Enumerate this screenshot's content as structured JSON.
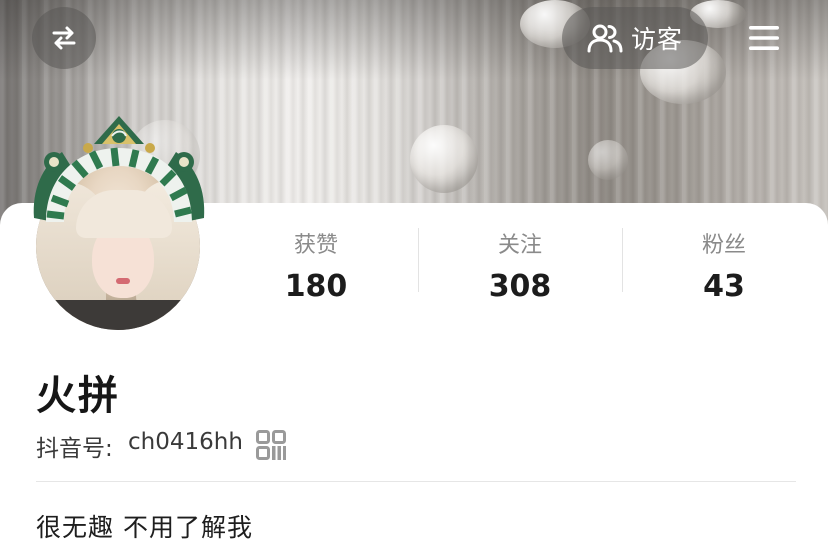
{
  "header": {
    "switch_icon": "switch-arrows-icon",
    "visitor_label": "访客",
    "visitor_icon": "people-icon",
    "menu_icon": "hamburger-menu-icon"
  },
  "stats": [
    {
      "label": "获赞",
      "value": "180"
    },
    {
      "label": "关注",
      "value": "308"
    },
    {
      "label": "粉丝",
      "value": "43"
    }
  ],
  "profile": {
    "name": "火拼",
    "id_label": "抖音号:",
    "id_value": "ch0416hh",
    "qr_icon": "qr-code-icon",
    "bio": "很无趣 不用了解我"
  },
  "colors": {
    "card_bg": "#ffffff",
    "text_primary": "#1c1c1c",
    "text_secondary": "#8a8a8a",
    "header_button_bg": "#5a5856"
  }
}
